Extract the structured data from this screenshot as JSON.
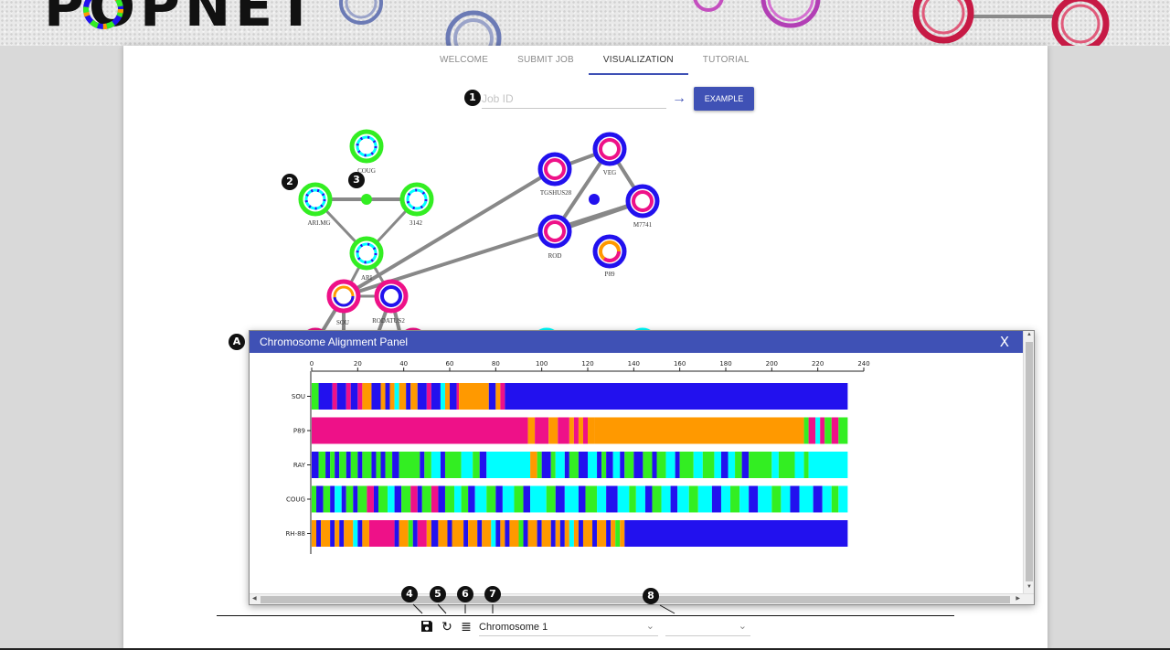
{
  "logo": "POPNET",
  "tabs": [
    "WELCOME",
    "SUBMIT JOB",
    "VISUALIZATION",
    "TUTORIAL"
  ],
  "active_tab": "VISUALIZATION",
  "job": {
    "placeholder": "Job ID",
    "value": "",
    "submit_icon": "arrow-right-icon",
    "example_label": "EXAMPLE"
  },
  "badges": [
    "1",
    "2",
    "3",
    "4",
    "5",
    "6",
    "7",
    "8",
    "A"
  ],
  "graph": {
    "nodes": [
      "COUG",
      "ARI.MG",
      "3142",
      "ARI",
      "TGSHUS28",
      "VEG",
      "M7741",
      "ROD",
      "P89",
      "SOU",
      "RODATUS2"
    ],
    "colors": {
      "green": "#33ee22",
      "magenta": "#ee1188",
      "blue": "#2211ee",
      "orange": "#ff9900",
      "cyan": "#00ffff",
      "edge": "#888888"
    }
  },
  "panel": {
    "title": "Chromosome Alignment Panel",
    "close_label": "X"
  },
  "chart_data": {
    "type": "bar",
    "title": "",
    "xlabel": "",
    "ylabel": "",
    "xlim": [
      0,
      240
    ],
    "xticks": [
      "0",
      "20",
      "40",
      "60",
      "80",
      "100",
      "120",
      "140",
      "160",
      "180",
      "200",
      "220",
      "240"
    ],
    "categories": [
      "SOU",
      "P89",
      "RAY",
      "COUG",
      "RH-88"
    ],
    "series_length": 233,
    "palette": {
      "B": "#2211ee",
      "O": "#ff9900",
      "M": "#ee1188",
      "G": "#33ee22",
      "C": "#00ffff"
    },
    "tracks": [
      [
        [
          0,
          3,
          "G"
        ],
        [
          3,
          9,
          "B"
        ],
        [
          9,
          11,
          "M"
        ],
        [
          11,
          15,
          "B"
        ],
        [
          15,
          17,
          "M"
        ],
        [
          17,
          20,
          "B"
        ],
        [
          20,
          22,
          "M"
        ],
        [
          22,
          26,
          "O"
        ],
        [
          26,
          30,
          "B"
        ],
        [
          30,
          32,
          "O"
        ],
        [
          32,
          34,
          "B"
        ],
        [
          34,
          36,
          "O"
        ],
        [
          36,
          38,
          "C"
        ],
        [
          38,
          41,
          "O"
        ],
        [
          41,
          43,
          "B"
        ],
        [
          43,
          46,
          "O"
        ],
        [
          46,
          50,
          "B"
        ],
        [
          50,
          52,
          "M"
        ],
        [
          52,
          56,
          "B"
        ],
        [
          56,
          58,
          "C"
        ],
        [
          58,
          60,
          "O"
        ],
        [
          60,
          63,
          "B"
        ],
        [
          63,
          64,
          "M"
        ],
        [
          64,
          77,
          "O"
        ],
        [
          77,
          80,
          "B"
        ],
        [
          80,
          82,
          "O"
        ],
        [
          82,
          84,
          "M"
        ],
        [
          84,
          233,
          "B"
        ]
      ],
      [
        [
          0,
          94,
          "M"
        ],
        [
          94,
          97,
          "O"
        ],
        [
          97,
          103,
          "M"
        ],
        [
          103,
          107,
          "O"
        ],
        [
          107,
          112,
          "M"
        ],
        [
          112,
          114,
          "O"
        ],
        [
          114,
          116,
          "M"
        ],
        [
          116,
          118,
          "O"
        ],
        [
          118,
          120,
          "M"
        ],
        [
          120,
          123,
          "O"
        ],
        [
          123,
          214,
          "O"
        ],
        [
          214,
          216,
          "G"
        ],
        [
          216,
          219,
          "M"
        ],
        [
          219,
          221,
          "C"
        ],
        [
          221,
          223,
          "M"
        ],
        [
          223,
          226,
          "G"
        ],
        [
          226,
          229,
          "M"
        ],
        [
          229,
          233,
          "G"
        ]
      ],
      [
        [
          0,
          3,
          "B"
        ],
        [
          3,
          6,
          "G"
        ],
        [
          6,
          8,
          "B"
        ],
        [
          8,
          10,
          "G"
        ],
        [
          10,
          12,
          "B"
        ],
        [
          12,
          15,
          "G"
        ],
        [
          15,
          17,
          "B"
        ],
        [
          17,
          20,
          "G"
        ],
        [
          20,
          22,
          "B"
        ],
        [
          22,
          26,
          "G"
        ],
        [
          26,
          28,
          "B"
        ],
        [
          28,
          30,
          "G"
        ],
        [
          30,
          32,
          "B"
        ],
        [
          32,
          35,
          "G"
        ],
        [
          35,
          38,
          "B"
        ],
        [
          38,
          47,
          "G"
        ],
        [
          47,
          49,
          "B"
        ],
        [
          49,
          52,
          "G"
        ],
        [
          52,
          56,
          "C"
        ],
        [
          56,
          58,
          "B"
        ],
        [
          58,
          65,
          "G"
        ],
        [
          65,
          70,
          "C"
        ],
        [
          70,
          73,
          "G"
        ],
        [
          73,
          76,
          "B"
        ],
        [
          76,
          95,
          "C"
        ],
        [
          95,
          98,
          "O"
        ],
        [
          98,
          100,
          "G"
        ],
        [
          100,
          104,
          "B"
        ],
        [
          104,
          106,
          "G"
        ],
        [
          106,
          110,
          "C"
        ],
        [
          110,
          112,
          "B"
        ],
        [
          112,
          116,
          "G"
        ],
        [
          116,
          120,
          "B"
        ],
        [
          120,
          124,
          "C"
        ],
        [
          124,
          126,
          "B"
        ],
        [
          126,
          128,
          "G"
        ],
        [
          128,
          131,
          "B"
        ],
        [
          131,
          134,
          "C"
        ],
        [
          134,
          136,
          "B"
        ],
        [
          136,
          140,
          "G"
        ],
        [
          140,
          144,
          "B"
        ],
        [
          144,
          148,
          "G"
        ],
        [
          148,
          150,
          "B"
        ],
        [
          150,
          154,
          "G"
        ],
        [
          154,
          158,
          "C"
        ],
        [
          158,
          160,
          "B"
        ],
        [
          160,
          166,
          "G"
        ],
        [
          166,
          170,
          "C"
        ],
        [
          170,
          175,
          "G"
        ],
        [
          175,
          178,
          "C"
        ],
        [
          178,
          181,
          "B"
        ],
        [
          181,
          184,
          "C"
        ],
        [
          184,
          187,
          "G"
        ],
        [
          187,
          190,
          "B"
        ],
        [
          190,
          200,
          "G"
        ],
        [
          200,
          203,
          "C"
        ],
        [
          203,
          210,
          "G"
        ],
        [
          210,
          214,
          "C"
        ],
        [
          214,
          216,
          "G"
        ],
        [
          216,
          233,
          "C"
        ]
      ],
      [
        [
          0,
          2,
          "G"
        ],
        [
          2,
          5,
          "B"
        ],
        [
          5,
          8,
          "G"
        ],
        [
          8,
          10,
          "B"
        ],
        [
          10,
          13,
          "C"
        ],
        [
          13,
          15,
          "B"
        ],
        [
          15,
          18,
          "G"
        ],
        [
          18,
          20,
          "B"
        ],
        [
          20,
          24,
          "G"
        ],
        [
          24,
          27,
          "M"
        ],
        [
          27,
          29,
          "B"
        ],
        [
          29,
          33,
          "G"
        ],
        [
          33,
          36,
          "C"
        ],
        [
          36,
          39,
          "B"
        ],
        [
          39,
          43,
          "G"
        ],
        [
          43,
          46,
          "M"
        ],
        [
          46,
          48,
          "B"
        ],
        [
          48,
          52,
          "G"
        ],
        [
          52,
          55,
          "M"
        ],
        [
          55,
          58,
          "B"
        ],
        [
          58,
          62,
          "G"
        ],
        [
          62,
          65,
          "C"
        ],
        [
          65,
          68,
          "G"
        ],
        [
          68,
          71,
          "B"
        ],
        [
          71,
          76,
          "C"
        ],
        [
          76,
          80,
          "G"
        ],
        [
          80,
          83,
          "B"
        ],
        [
          83,
          88,
          "C"
        ],
        [
          88,
          92,
          "G"
        ],
        [
          92,
          95,
          "B"
        ],
        [
          95,
          102,
          "C"
        ],
        [
          102,
          106,
          "G"
        ],
        [
          106,
          110,
          "B"
        ],
        [
          110,
          116,
          "C"
        ],
        [
          116,
          119,
          "B"
        ],
        [
          119,
          124,
          "G"
        ],
        [
          124,
          128,
          "C"
        ],
        [
          128,
          133,
          "B"
        ],
        [
          133,
          138,
          "C"
        ],
        [
          138,
          141,
          "G"
        ],
        [
          141,
          145,
          "C"
        ],
        [
          145,
          148,
          "B"
        ],
        [
          148,
          152,
          "G"
        ],
        [
          152,
          156,
          "C"
        ],
        [
          156,
          159,
          "B"
        ],
        [
          159,
          164,
          "C"
        ],
        [
          164,
          168,
          "G"
        ],
        [
          168,
          174,
          "C"
        ],
        [
          174,
          178,
          "B"
        ],
        [
          178,
          182,
          "C"
        ],
        [
          182,
          186,
          "G"
        ],
        [
          186,
          190,
          "C"
        ],
        [
          190,
          194,
          "B"
        ],
        [
          194,
          200,
          "C"
        ],
        [
          200,
          204,
          "G"
        ],
        [
          204,
          208,
          "C"
        ],
        [
          208,
          212,
          "B"
        ],
        [
          212,
          218,
          "C"
        ],
        [
          218,
          222,
          "B"
        ],
        [
          222,
          226,
          "C"
        ],
        [
          226,
          229,
          "G"
        ],
        [
          229,
          233,
          "C"
        ]
      ],
      [
        [
          0,
          2,
          "O"
        ],
        [
          2,
          4,
          "B"
        ],
        [
          4,
          8,
          "O"
        ],
        [
          8,
          10,
          "B"
        ],
        [
          10,
          12,
          "O"
        ],
        [
          12,
          14,
          "B"
        ],
        [
          14,
          18,
          "O"
        ],
        [
          18,
          20,
          "C"
        ],
        [
          20,
          22,
          "B"
        ],
        [
          22,
          25,
          "O"
        ],
        [
          25,
          36,
          "M"
        ],
        [
          36,
          38,
          "B"
        ],
        [
          38,
          42,
          "O"
        ],
        [
          42,
          44,
          "G"
        ],
        [
          44,
          46,
          "B"
        ],
        [
          46,
          50,
          "M"
        ],
        [
          50,
          52,
          "O"
        ],
        [
          52,
          55,
          "B"
        ],
        [
          55,
          59,
          "O"
        ],
        [
          59,
          61,
          "B"
        ],
        [
          61,
          66,
          "O"
        ],
        [
          66,
          68,
          "B"
        ],
        [
          68,
          72,
          "O"
        ],
        [
          72,
          74,
          "B"
        ],
        [
          74,
          78,
          "O"
        ],
        [
          78,
          80,
          "C"
        ],
        [
          80,
          82,
          "B"
        ],
        [
          82,
          84,
          "O"
        ],
        [
          84,
          86,
          "B"
        ],
        [
          86,
          90,
          "O"
        ],
        [
          90,
          92,
          "G"
        ],
        [
          92,
          94,
          "B"
        ],
        [
          94,
          98,
          "O"
        ],
        [
          98,
          100,
          "B"
        ],
        [
          100,
          104,
          "O"
        ],
        [
          104,
          106,
          "B"
        ],
        [
          106,
          108,
          "O"
        ],
        [
          108,
          110,
          "B"
        ],
        [
          110,
          112,
          "O"
        ],
        [
          112,
          114,
          "C"
        ],
        [
          114,
          116,
          "O"
        ],
        [
          116,
          118,
          "B"
        ],
        [
          118,
          122,
          "O"
        ],
        [
          122,
          124,
          "B"
        ],
        [
          124,
          128,
          "O"
        ],
        [
          128,
          130,
          "B"
        ],
        [
          130,
          132,
          "O"
        ],
        [
          132,
          134,
          "G"
        ],
        [
          134,
          136,
          "O"
        ],
        [
          136,
          233,
          "B"
        ]
      ]
    ]
  },
  "toolbar": {
    "save_icon": "save-icon",
    "refresh_icon": "refresh-icon",
    "list_icon": "list-icon",
    "chromosome_select": "Chromosome 1",
    "secondary_select": ""
  }
}
